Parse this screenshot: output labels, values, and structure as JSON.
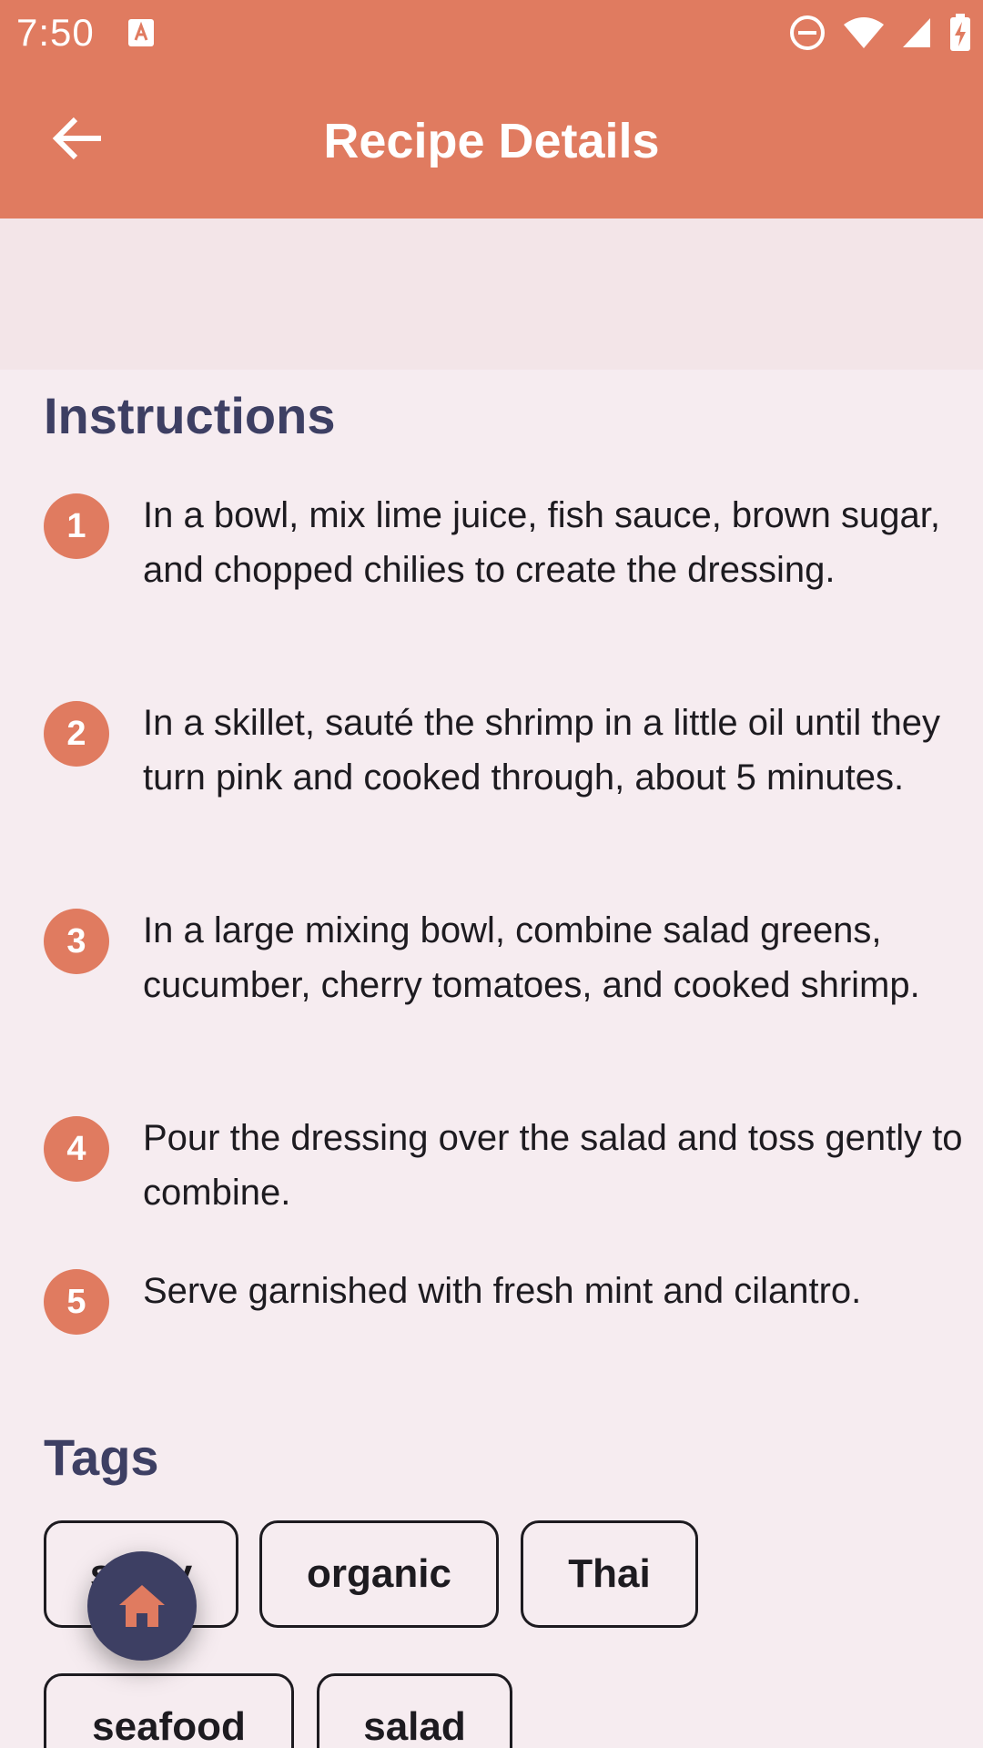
{
  "status_bar": {
    "time": "7:50",
    "icons": [
      "a-icon",
      "do-not-disturb-icon",
      "wifi-icon",
      "signal-icon",
      "battery-charging-icon"
    ]
  },
  "app_bar": {
    "back_icon": "arrow-left-icon",
    "title": "Recipe Details"
  },
  "instructions": {
    "title": "Instructions",
    "steps": [
      {
        "number": "1",
        "text": "In a bowl, mix lime juice, fish sauce, brown sugar, and chopped chilies to create the dressing."
      },
      {
        "number": "2",
        "text": "In a skillet, sauté the shrimp in a little oil until they turn pink and cooked through, about 5 minutes."
      },
      {
        "number": "3",
        "text": "In a large mixing bowl, combine salad greens, cucumber, cherry tomatoes, and cooked shrimp."
      },
      {
        "number": "4",
        "text": "Pour the dressing over the salad and toss gently to combine."
      },
      {
        "number": "5",
        "text": "Serve garnished with fresh mint and cilantro."
      }
    ]
  },
  "tags": {
    "title": "Tags",
    "items": [
      "spicy",
      "organic",
      "Thai",
      "seafood",
      "salad"
    ]
  },
  "fab": {
    "icon": "home-icon"
  },
  "colors": {
    "primary": "#e07b60",
    "secondary": "#3d3f63",
    "background": "#f6ecf0"
  }
}
